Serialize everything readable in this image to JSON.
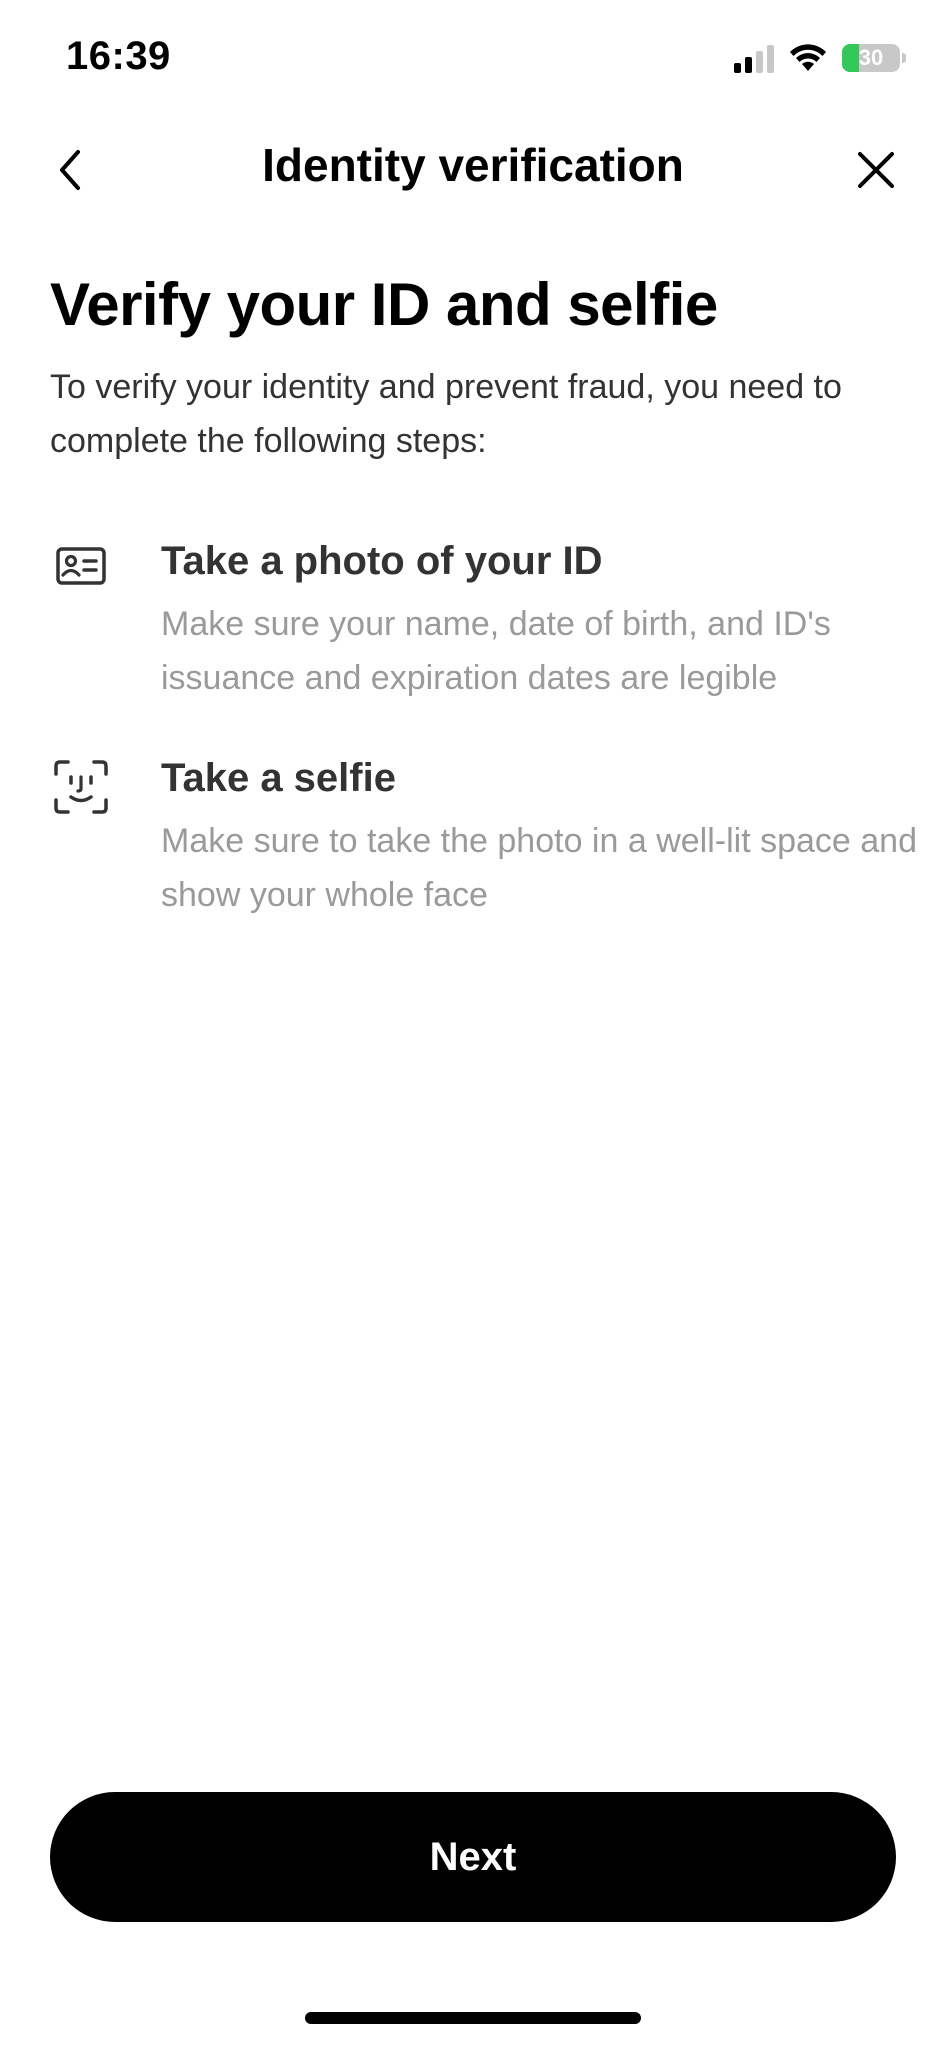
{
  "status_bar": {
    "time": "16:39",
    "battery": "30",
    "battery_level": 0.3,
    "signal_icon": "cellular-signal-icon",
    "wifi_icon": "wifi-icon",
    "battery_icon": "battery-charging-icon"
  },
  "nav": {
    "title": "Identity verification",
    "back_icon": "chevron-left-icon",
    "close_icon": "close-icon"
  },
  "main": {
    "headline": "Verify your ID and selfie",
    "subtitle": "To verify your identity and prevent fraud, you need to complete the following steps:",
    "steps": [
      {
        "icon": "id-card-icon",
        "title": "Take a photo of your ID",
        "description": "Make sure your name, date of birth, and ID's issuance and expiration dates are legible"
      },
      {
        "icon": "face-scan-icon",
        "title": "Take a selfie",
        "description": "Make sure to take the photo in a well-lit space and show your whole face"
      }
    ]
  },
  "footer": {
    "next_label": "Next"
  },
  "colors": {
    "primary_button": "#000000",
    "title_text": "#333333",
    "muted_text": "#9a9a9a",
    "battery_green": "#34c759"
  }
}
